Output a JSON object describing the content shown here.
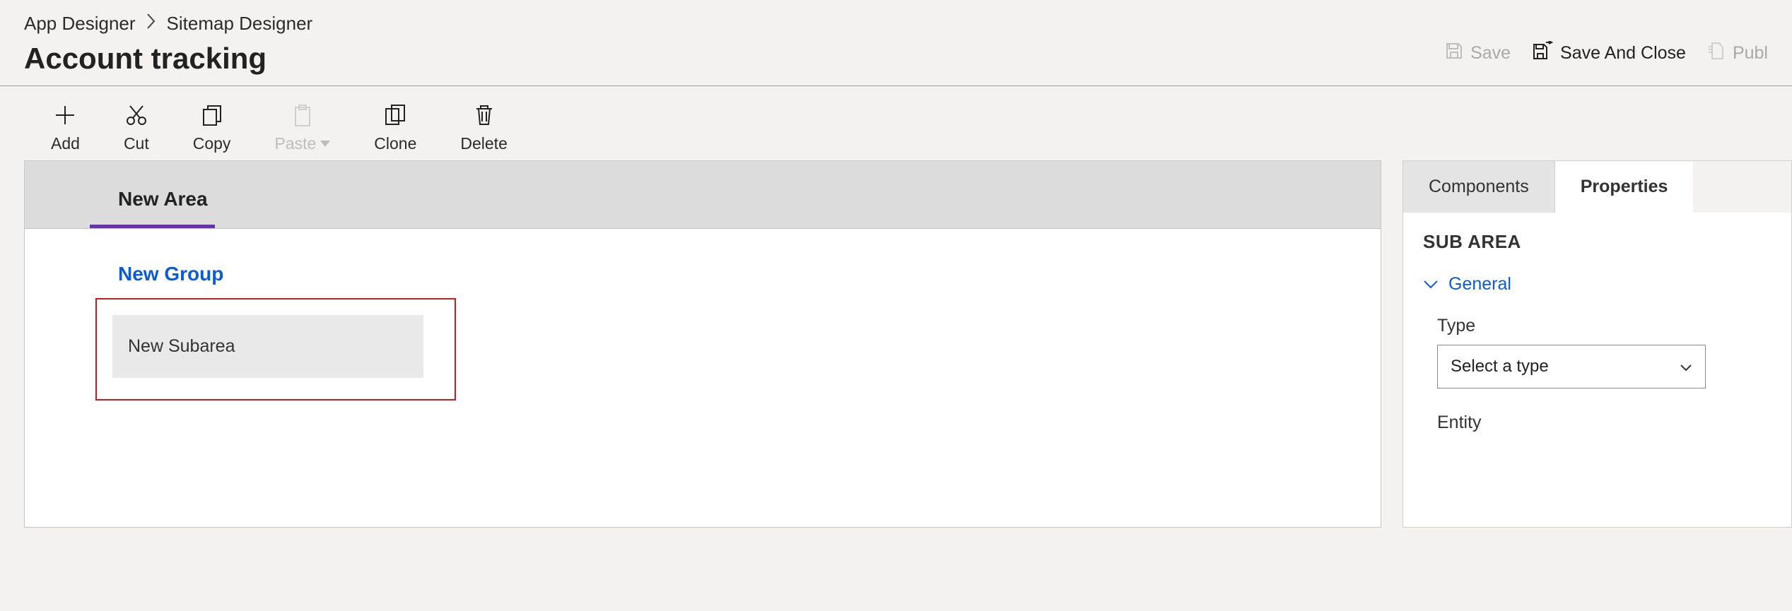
{
  "breadcrumb": {
    "root": "App Designer",
    "current": "Sitemap Designer"
  },
  "page_title": "Account tracking",
  "header_actions": {
    "save": "Save",
    "save_and_close": "Save And Close",
    "publish": "Publ"
  },
  "toolbar": {
    "add": "Add",
    "cut": "Cut",
    "copy": "Copy",
    "paste": "Paste",
    "clone": "Clone",
    "delete": "Delete"
  },
  "canvas": {
    "area_tab": "New Area",
    "group_title": "New Group",
    "subarea_label": "New Subarea"
  },
  "right_pane": {
    "tabs": {
      "components": "Components",
      "properties": "Properties"
    },
    "heading": "SUB AREA",
    "section_general": "General",
    "field_type_label": "Type",
    "field_type_placeholder": "Select a type",
    "field_entity_label": "Entity"
  }
}
